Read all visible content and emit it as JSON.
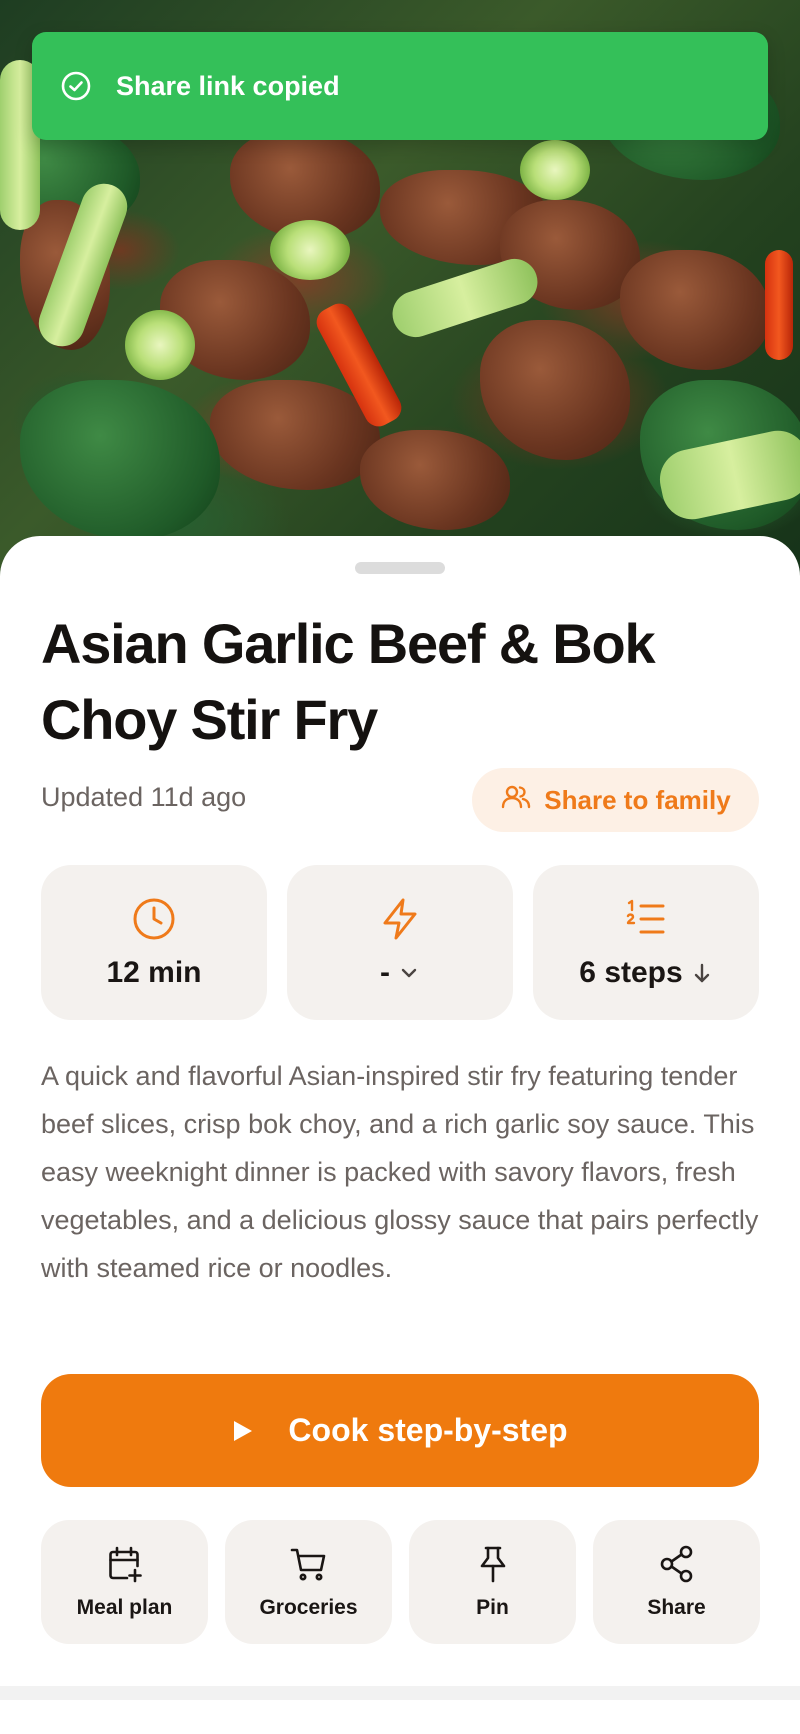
{
  "toast": {
    "message": "Share link copied",
    "color": "#34c059",
    "icon": "check-circle-icon"
  },
  "recipe": {
    "title": "Asian Garlic Beef & Bok Choy Stir Fry",
    "updated": "Updated 11d ago",
    "share_family_label": "Share to family",
    "stats": {
      "time": "12 min",
      "difficulty": "-",
      "steps": "6 steps"
    },
    "description": "A quick and flavorful Asian-inspired stir fry featuring tender beef slices, crisp bok choy, and a rich garlic soy sauce. This easy weeknight dinner is packed with savory flavors, fresh vegetables, and a delicious glossy sauce that pairs perfectly with steamed rice or noodles.",
    "cook_label": "Cook step-by-step"
  },
  "actions": [
    {
      "label": "Meal plan",
      "icon": "calendar-plus-icon"
    },
    {
      "label": "Groceries",
      "icon": "cart-icon"
    },
    {
      "label": "Pin",
      "icon": "pin-icon"
    },
    {
      "label": "Share",
      "icon": "share-icon"
    }
  ],
  "colors": {
    "accent": "#ef7a0e",
    "accent_soft": "#fdf0e5",
    "card": "#f4f1ee",
    "muted_text": "#6b6461"
  }
}
